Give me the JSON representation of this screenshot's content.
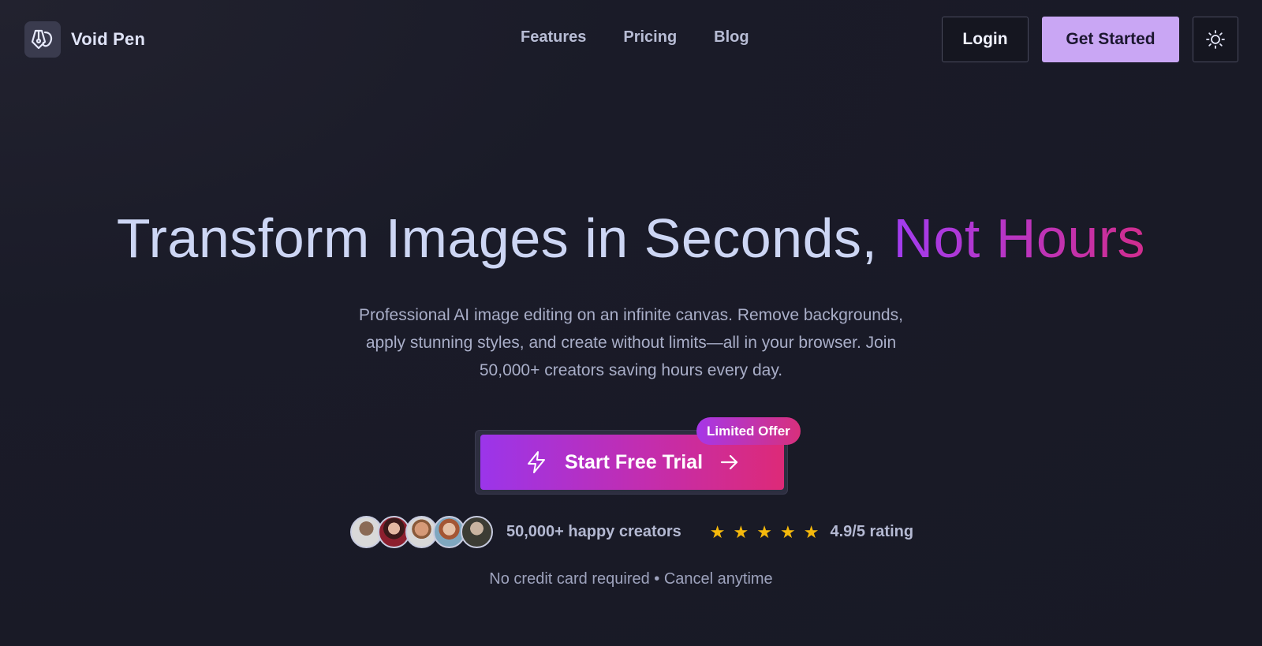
{
  "brand": {
    "name": "Void Pen",
    "logo_icon": "pen-nib-icon"
  },
  "nav": {
    "links": [
      "Features",
      "Pricing",
      "Blog"
    ],
    "login_label": "Login",
    "get_started_label": "Get Started",
    "theme_icon": "sun-icon"
  },
  "hero": {
    "title_main": "Transform Images in Seconds, ",
    "title_accent": "Not Hours",
    "subtitle": "Professional AI image editing on an infinite canvas. Remove backgrounds, apply stunning styles, and create without limits—all in your browser. Join 50,000+ creators saving hours every day."
  },
  "cta": {
    "label": "Start Free Trial",
    "badge": "Limited Offer",
    "leading_icon": "lightning-icon",
    "trailing_icon": "arrow-right-icon"
  },
  "social_proof": {
    "creators_text": "50,000+ happy creators",
    "rating_text": "4.9/5 rating",
    "rating_value": 5,
    "avatar_colors": [
      "#6b5648",
      "#8a2c36",
      "#a37a60",
      "#6a8ca0",
      "#777777"
    ]
  },
  "fineprint": "No credit card required • Cancel anytime",
  "colors": {
    "background": "#1a1b28",
    "accent_purple": "#a23cf0",
    "accent_pink": "#d12d8e",
    "nav_cta": "#c9a6f4",
    "star": "#f5b90c"
  }
}
